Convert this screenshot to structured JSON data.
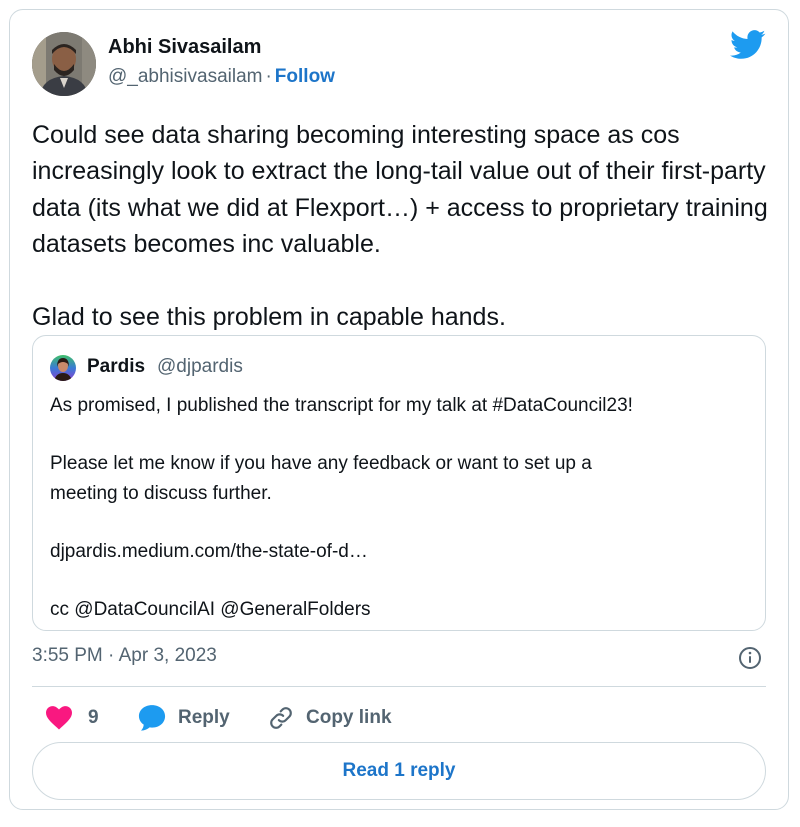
{
  "colors": {
    "accent": "#1d75c9",
    "twitter_blue": "#1d9bf0",
    "like_red": "#f91880",
    "muted": "#536471",
    "border": "#cfd9de"
  },
  "author": {
    "name": "Abhi Sivasailam",
    "handle": "@_abhisivasailam",
    "separator": "·",
    "follow_label": "Follow",
    "avatar_icon": "user-photo"
  },
  "brand_icon": "twitter-bird-icon",
  "tweet": {
    "text": "Could see data sharing becoming interesting space as cos increasingly look to extract the long-tail value out of their first-party data (its what we did at Flexport…) + access to proprietary training datasets becomes inc valuable.\n\nGlad to see this problem in capable hands."
  },
  "quoted_tweet": {
    "name": "Pardis",
    "handle": "@djpardis",
    "text": "As promised, I published the transcript for my talk at #DataCouncil23!\n\nPlease let me know if you have any feedback or want to set up a\nmeeting to discuss further.\n\ndjpardis.medium.com/the-state-of-d…\n\ncc @DataCouncilAI @GeneralFolders"
  },
  "meta": {
    "timestamp": "3:55 PM · Apr 3, 2023",
    "info_icon": "info-icon"
  },
  "actions": {
    "like_count": "9",
    "reply_label": "Reply",
    "copy_link_label": "Copy link"
  },
  "read_replies_label": "Read 1 reply"
}
